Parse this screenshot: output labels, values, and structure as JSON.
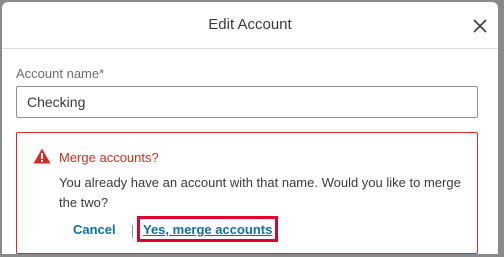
{
  "dialog": {
    "title": "Edit Account",
    "close_icon": "close-icon"
  },
  "form": {
    "account_name_label": "Account name*",
    "account_name_value": "Checking"
  },
  "alert": {
    "icon": "warning-icon",
    "title": "Merge accounts?",
    "message": "You already have an account with that name. Would you like to merge the two?",
    "cancel_label": "Cancel",
    "separator": "|",
    "confirm_label": "Yes, merge accounts"
  },
  "colors": {
    "error": "#e0282e",
    "link": "#0d6fa8",
    "highlight": "#e0002b"
  }
}
